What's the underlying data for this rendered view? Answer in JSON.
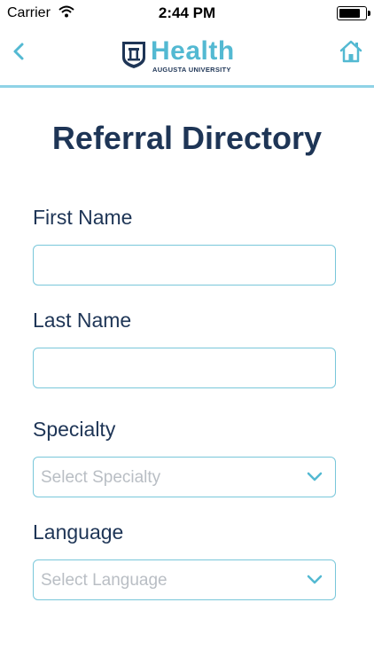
{
  "status_bar": {
    "carrier": "Carrier",
    "time": "2:44 PM",
    "battery_level": 0.9
  },
  "header": {
    "logo_word": "Health",
    "logo_sub": "AUGUSTA UNIVERSITY",
    "back_icon": "chevron-left-icon",
    "home_icon": "home-icon"
  },
  "page": {
    "title": "Referral Directory"
  },
  "form": {
    "first_name_label": "First Name",
    "first_name_value": "",
    "last_name_label": "Last Name",
    "last_name_value": "",
    "specialty_label": "Specialty",
    "specialty_placeholder": "Select Specialty",
    "language_label": "Language",
    "language_placeholder": "Select Language"
  },
  "colors": {
    "accent": "#53b9d2",
    "border": "#79c7da",
    "text_dark": "#1e3556",
    "placeholder": "#b9bec4"
  }
}
